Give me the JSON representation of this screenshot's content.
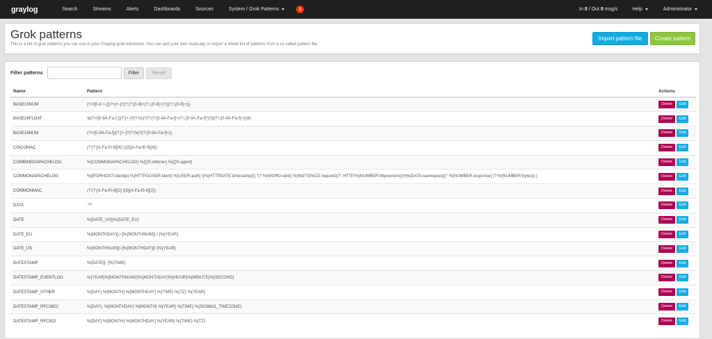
{
  "navbar": {
    "logo": "graylog",
    "items": [
      {
        "label": "Search"
      },
      {
        "label": "Streams"
      },
      {
        "label": "Alerts"
      },
      {
        "label": "Dashboards"
      },
      {
        "label": "Sources"
      },
      {
        "label": "System / Grok Patterns"
      }
    ],
    "notification_count": "1",
    "throughput_in": "0",
    "throughput_out": "0",
    "throughput_prefix": "In",
    "throughput_sep": "/ Out",
    "throughput_unit": "msg/s",
    "help_label": "Help",
    "user_label": "Administrator"
  },
  "header": {
    "title": "Grok patterns",
    "description": "This is a list of grok patterns you can use in your Graylog grok extractors. You can add your own manually or import a whole list of patterns from a so called pattern file.",
    "import_label": "Import pattern file",
    "create_label": "Create pattern"
  },
  "filter": {
    "label": "Filter patterns",
    "value": "",
    "filter_label": "Filter",
    "reset_label": "Reset"
  },
  "table": {
    "headers": {
      "name": "Name",
      "pattern": "Pattern",
      "actions": "Actions"
    },
    "delete_label": "Delete",
    "edit_label": "Edit",
    "rows": [
      {
        "name": "BASE10NUM",
        "pattern": "(?<![0-9.+-])(?>[+-]?(?:(?:[0-9]+(?:\\.[0-9]+)?)|(?:\\.[0-9]+)))"
      },
      {
        "name": "BASE16FLOAT",
        "pattern": "\\b(?<![0-9A-Fa-f.])(?:[+-]?(?:0x)?(?:(?:[0-9A-Fa-f]+(?:\\.[0-9A-Fa-f]*)?)|(?:\\.[0-9A-Fa-f]+)))\\b"
      },
      {
        "name": "BASE16NUM",
        "pattern": "(?<![0-9A-Fa-f])(?:[+-]?(?:0x)?(?:[0-9A-Fa-f]+))"
      },
      {
        "name": "CISCOMAC",
        "pattern": "(?:(?:[A-Fa-f0-9]{4}\\.){2}[A-Fa-f0-9]{4})"
      },
      {
        "name": "COMBINEDAPACHELOG",
        "pattern": "%{COMMONAPACHELOG} %{QS:referrer} %{QS:agent}"
      },
      {
        "name": "COMMONAPACHELOG",
        "pattern": "%{IPORHOST:clientip} %{HTTPDUSER:ident} %{USER:auth} \\[%{HTTPDATE:timestamp}\\] \"(?:%{WORD:verb} %{NOTSPACE:request}(?: HTTP/%{NUMBER:httpversion})?|%{DATA:rawrequest})\" %{NUMBER:response} (?:%{NUMBER:bytes}|-)"
      },
      {
        "name": "COMMONMAC",
        "pattern": "(?:(?:[A-Fa-f0-9]{2}:){5}[A-Fa-f0-9]{2})"
      },
      {
        "name": "DATA",
        "pattern": ".*?"
      },
      {
        "name": "DATE",
        "pattern": "%{DATE_US}|%{DATE_EU}"
      },
      {
        "name": "DATE_EU",
        "pattern": "%{MONTHDAY}[./-]%{MONTHNUM}[./-]%{YEAR}"
      },
      {
        "name": "DATE_US",
        "pattern": "%{MONTHNUM}[/-]%{MONTHDAY}[/-]%{YEAR}"
      },
      {
        "name": "DATESTAMP",
        "pattern": "%{DATE}[- ]%{TIME}"
      },
      {
        "name": "DATESTAMP_EVENTLOG",
        "pattern": "%{YEAR}%{MONTHNUM2}%{MONTHDAY}%{HOUR}%{MINUTE}%{SECOND}"
      },
      {
        "name": "DATESTAMP_OTHER",
        "pattern": "%{DAY} %{MONTH} %{MONTHDAY} %{TIME} %{TZ} %{YEAR}"
      },
      {
        "name": "DATESTAMP_RFC2822",
        "pattern": "%{DAY}, %{MONTHDAY} %{MONTH} %{YEAR} %{TIME} %{ISO8601_TIMEZONE}"
      },
      {
        "name": "DATESTAMP_RFC822",
        "pattern": "%{DAY} %{MONTH} %{MONTHDAY} %{YEAR} %{TIME} %{TZ}"
      }
    ]
  }
}
